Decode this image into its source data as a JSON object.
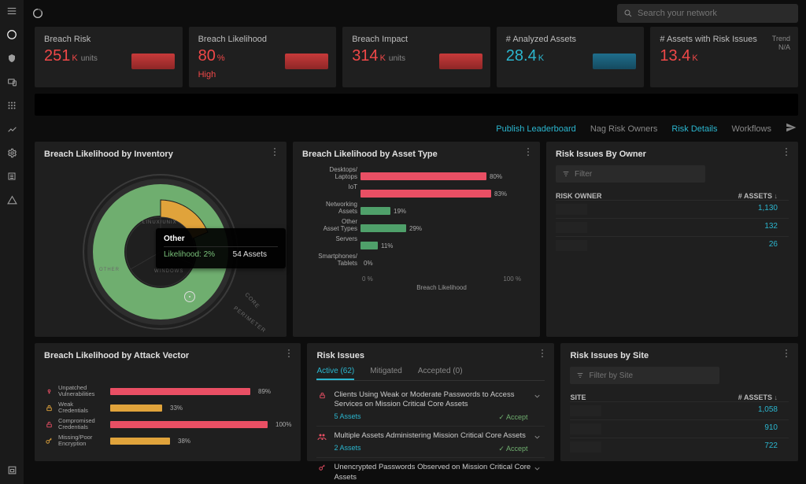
{
  "search": {
    "placeholder": "Search your network"
  },
  "kpis": [
    {
      "title": "Breach Risk",
      "value": "251",
      "suffix": "K",
      "units": "units",
      "spark_color": "#c73a3a"
    },
    {
      "title": "Breach Likelihood",
      "value": "80",
      "suffix": "%",
      "sub": "High",
      "spark_color": "#c73a3a"
    },
    {
      "title": "Breach Impact",
      "value": "314",
      "suffix": "K",
      "units": "units",
      "spark_color": "#c73a3a"
    },
    {
      "title": "# Analyzed Assets",
      "value": "28.4",
      "suffix": "K",
      "spark_color": "#1f6e8c",
      "value_class": "cyan-v"
    },
    {
      "title": "# Assets with Risk Issues",
      "value": "13.4",
      "suffix": "K",
      "trend_label": "Trend",
      "trend_value": "N/A"
    }
  ],
  "links": {
    "publish": "Publish Leaderboard",
    "nag": "Nag Risk Owners",
    "details": "Risk Details",
    "workflows": "Workflows"
  },
  "panels": {
    "inventory": {
      "title": "Breach Likelihood by Inventory"
    },
    "asset_type": {
      "title": "Breach Likelihood by Asset Type",
      "axis_label": "Breach Likelihood",
      "axis_min": "0 %",
      "axis_max": "100 %"
    },
    "owner": {
      "title": "Risk Issues By Owner",
      "col1": "RISK OWNER",
      "col2": "# ASSETS",
      "filter_placeholder": "Filter"
    },
    "attack": {
      "title": "Breach Likelihood by Attack Vector"
    },
    "issues": {
      "title": "Risk Issues"
    },
    "site": {
      "title": "Risk Issues by Site",
      "col1": "SITE",
      "col2": "# ASSETS",
      "filter_placeholder": "Filter by Site"
    }
  },
  "tooltip": {
    "name": "Other",
    "likelihood_label": "Likelihood: 2%",
    "assets_label": "54 Assets"
  },
  "donut_labels": {
    "core": "CORE",
    "perimeter": "PERIMETER",
    "other": "OTHER",
    "windows": "WINDOWS",
    "linux": "LINUX/UNIX"
  },
  "chart_data": {
    "asset_type_bars": {
      "type": "bar",
      "xlabel": "Breach Likelihood",
      "xlim": [
        0,
        100
      ],
      "series": [
        {
          "name": "Desktops/\nLaptops",
          "value": 80,
          "color": "#e94f64"
        },
        {
          "name": "IoT",
          "value": 83,
          "color": "#e94f64"
        },
        {
          "name": "Networking\nAssets",
          "value": 19,
          "color": "#4fa06a"
        },
        {
          "name": "Other\nAsset Types",
          "value": 29,
          "color": "#4fa06a"
        },
        {
          "name": "Servers",
          "value": 11,
          "color": "#4fa06a"
        },
        {
          "name": "Smartphones/\nTablets",
          "value": 0,
          "color": "#4fa06a"
        }
      ]
    },
    "attack_vector_bars": {
      "type": "bar",
      "series": [
        {
          "name": "Unpatched\nVulnerabilities",
          "value": 89,
          "color": "#e94f64",
          "icon_color": "#e94f64"
        },
        {
          "name": "Weak\nCredentials",
          "value": 33,
          "color": "#e0a33b",
          "icon_color": "#e0a33b"
        },
        {
          "name": "Compromised\nCredentials",
          "value": 100,
          "color": "#e94f64",
          "icon_color": "#e94f64"
        },
        {
          "name": "Missing/Poor\nEncryption",
          "value": 38,
          "color": "#e0a33b",
          "icon_color": "#e0a33b"
        }
      ]
    },
    "owner_rows": [
      {
        "assets": "1,130"
      },
      {
        "assets": "132"
      },
      {
        "assets": "26"
      }
    ],
    "site_rows": [
      {
        "assets": "1,058"
      },
      {
        "assets": "910"
      },
      {
        "assets": "722"
      }
    ]
  },
  "issues_tabs": {
    "active": "Active (62)",
    "mitigated": "Mitigated",
    "accepted": "Accepted (0)"
  },
  "issues": [
    {
      "text": "Clients Using Weak or Moderate Passwords to Access Services on Mission Critical Core Assets",
      "count": "5 Assets",
      "accept": "✓ Accept",
      "icon": "lock",
      "icon_color": "#e94f64"
    },
    {
      "text": "Multiple Assets Administering Mission Critical Core Assets",
      "count": "2 Assets",
      "accept": "✓ Accept",
      "icon": "users",
      "icon_color": "#e94f64"
    },
    {
      "text": "Unencrypted Passwords Observed on Mission Critical Core Assets",
      "count": "",
      "accept": "",
      "icon": "key",
      "icon_color": "#e94f64"
    }
  ]
}
